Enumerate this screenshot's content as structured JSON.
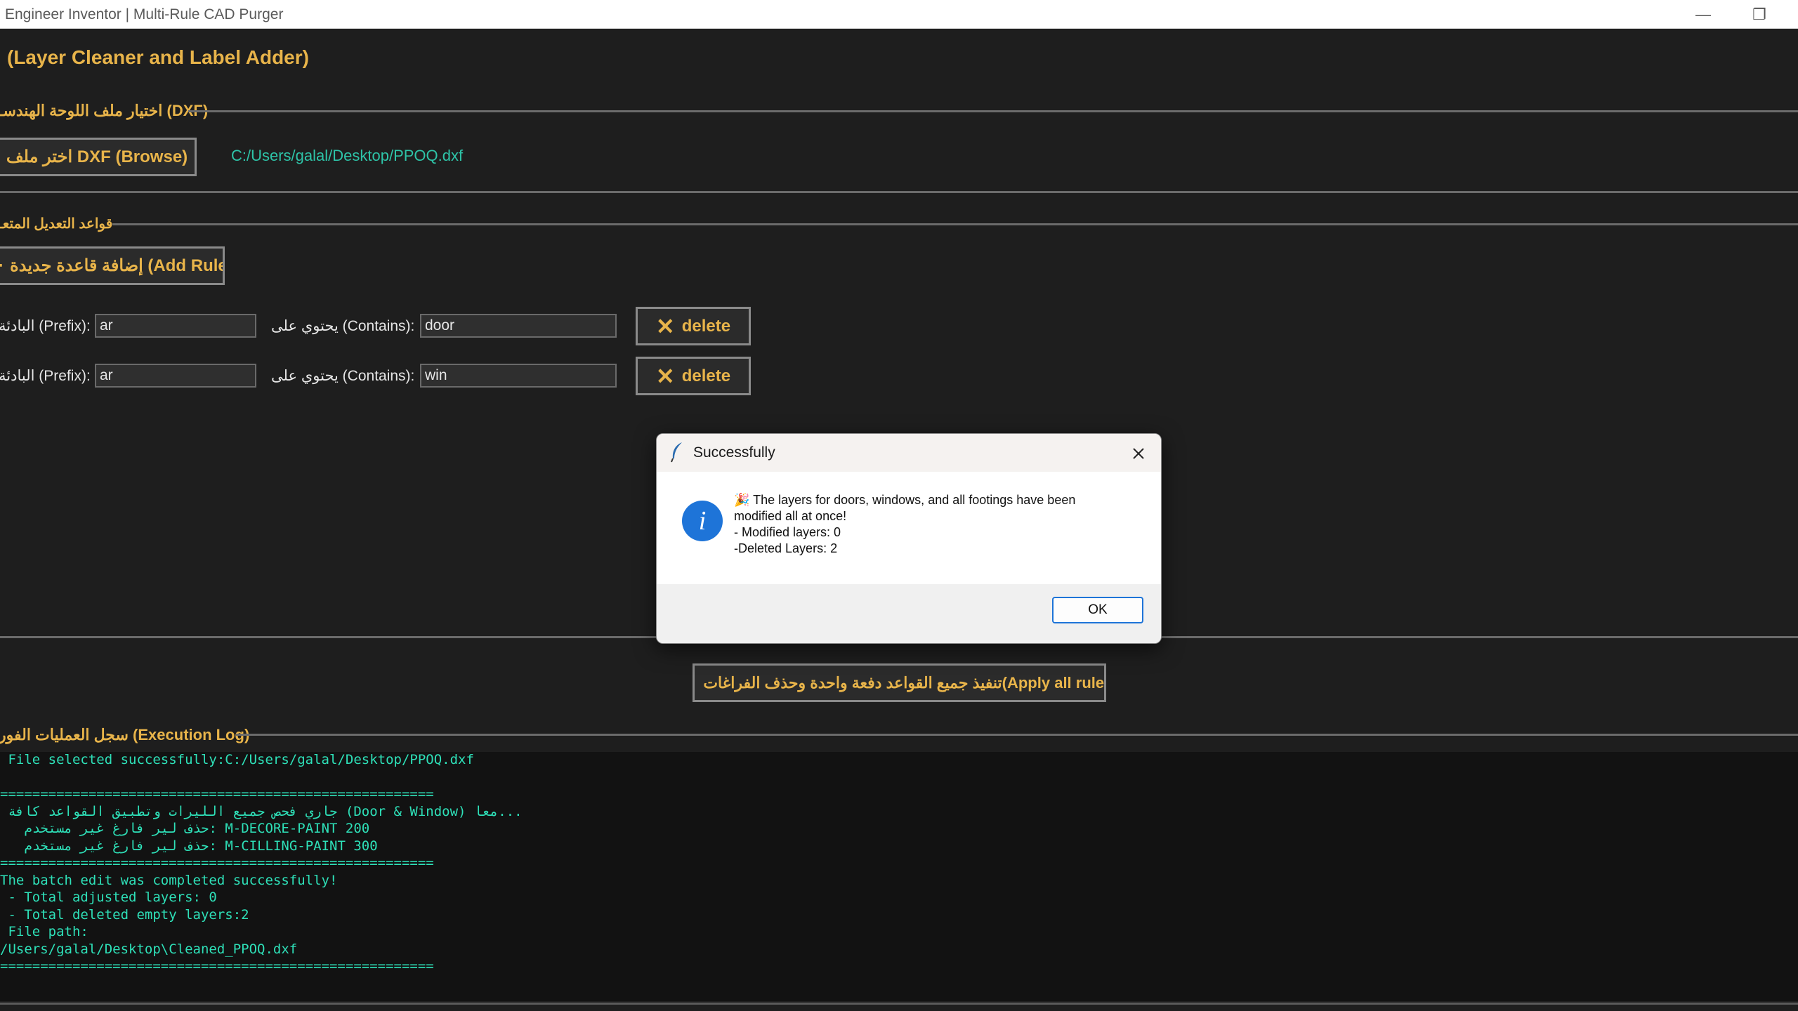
{
  "window": {
    "title": "Engineer Inventor | Multi-Rule CAD Purger",
    "minimize_glyph": "—",
    "restore_glyph": "❐"
  },
  "header": {
    "title": "(Layer Cleaner and Label Adder)"
  },
  "file_section": {
    "legend": "اختيار ملف اللوحة الهندسـ (DXF)",
    "browse_label": "اختر ملف DXF (Browse)",
    "selected_path": "C:/Users/galal/Desktop/PPOQ.dxf"
  },
  "rules_section": {
    "legend": "قواعد التعديل المتعـ",
    "add_rule_label": "إضافة قاعدة جديدة (Add Rule)",
    "prefix_label": "البادئة (Prefix):",
    "contains_label": "يحتوي على (Contains):",
    "delete_label": "delete",
    "rules": [
      {
        "prefix": "ar",
        "contains": "door"
      },
      {
        "prefix": "ar",
        "contains": "win"
      }
    ]
  },
  "apply_button": {
    "label": "تنفيذ جميع القواعد دفعة واحدة وحذف الفراغات(Apply all rules)"
  },
  "log_section": {
    "legend": "سجل العمليات الفور (Execution Log)",
    "lines": [
      " File selected successfully:C:/Users/galal/Desktop/PPOQ.dxf",
      "",
      "======================================================",
      " جاري فحص جميع الليرات وتطبيق القواعد كافة (Door & Window) معا...",
      "   حذف لير فارغ غير مستخدم: M-DECORE-PAINT 200",
      "   حذف لير فارغ غير مستخدم: M-CILLING-PAINT 300",
      "======================================================",
      "The batch edit was completed successfully!",
      " - Total adjusted layers: 0",
      " - Total deleted empty layers:2",
      " File path:",
      "/Users/galal/Desktop\\Cleaned_PPOQ.dxf",
      "======================================================"
    ]
  },
  "dialog": {
    "title": "Successfully",
    "message_lines": [
      "🎉 The layers for doors, windows, and all footings have been",
      "modified all at once!",
      "- Modified layers: 0",
      "-Deleted Layers: 2"
    ],
    "ok_label": "OK",
    "info_glyph": "i"
  },
  "colors": {
    "accent": "#e8b44a",
    "path_text": "#2ec4a8",
    "log_text": "#2ee0b8",
    "background": "#1e1e1e",
    "info_blue": "#1e74d8"
  }
}
